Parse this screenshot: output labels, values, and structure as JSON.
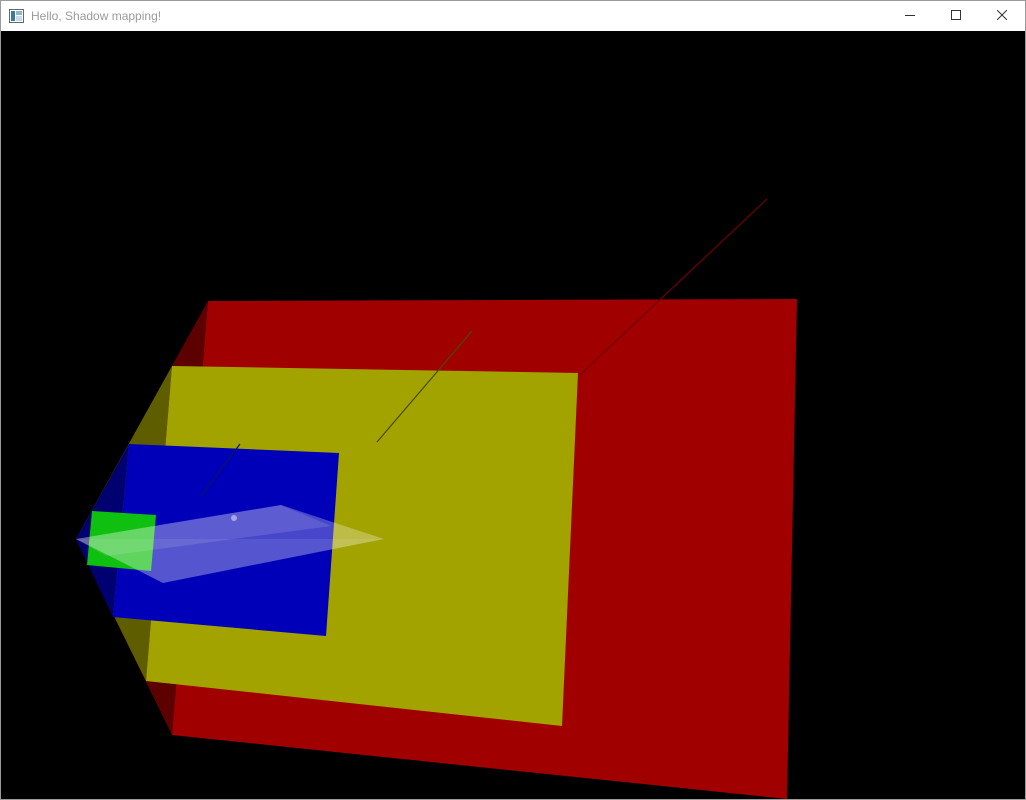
{
  "window": {
    "title": "Hello, Shadow mapping!",
    "controls": {
      "minimize_icon": "minimize-icon",
      "maximize_icon": "maximize-icon",
      "close_icon": "close-icon"
    }
  },
  "scene": {
    "background": "#000000",
    "colors": {
      "red_plane": "#a00000",
      "red_side": "#5c0000",
      "yellow_plane": "#a3a300",
      "yellow_side": "#5e5e00",
      "blue_plane": "#0000b8",
      "blue_side": "#000070",
      "green_plane": "#10c010",
      "light_frustum": "#ffffff",
      "ray_red": "#700000",
      "ray_yellow": "#4a4a00",
      "ray_blue": "#101060"
    }
  }
}
